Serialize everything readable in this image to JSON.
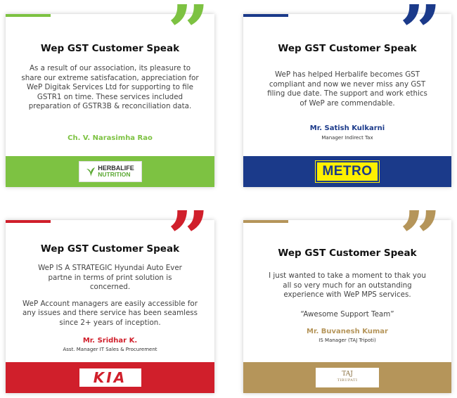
{
  "colors": {
    "green": "#7dc242",
    "blue": "#1b3a8a",
    "red": "#d01f2b",
    "gold": "#b5955a",
    "metro_yellow": "#fff000"
  },
  "quote_glyph": "”",
  "cards": [
    {
      "title": "Wep GST Customer Speak",
      "body": [
        "As a result of our association, its pleasure to share our extreme satisfacation, appreciation for WeP Digitak Services Ltd for supporting to file GSTR1 on time. These services included preparation of GSTR3B & reconciliation data."
      ],
      "name": "Ch. V. Narasimha Rao",
      "role": "",
      "logo": {
        "icon": "herbalife-leaf-icon",
        "line1": "HERBALIFE",
        "line2": "NUTRITION"
      }
    },
    {
      "title": "Wep GST Customer Speak",
      "body": [
        "WeP has  helped Herbalife becomes GST compliant and now we never miss any GST filing due date. The support and work ethics of WeP are commendable."
      ],
      "name": "Mr. Satish Kulkarni",
      "role": "Manager Indirect Tax",
      "logo": {
        "text": "METRO"
      }
    },
    {
      "title": "Wep GST Customer Speak",
      "body": [
        "WeP IS A STRATEGIC Hyundai Auto Ever partne in terms of print solution is concerned.",
        "WeP Account managers are easily accessible for any issues and there service has been seamless since 2+ years of inception."
      ],
      "name": "Mr. Sridhar K.",
      "role": "Asst. Manager IT Sales & Procurement",
      "logo": {
        "text": "KIA"
      }
    },
    {
      "title": "Wep GST Customer Speak",
      "body": [
        "I just wanted to take a moment to thak you all so very much for an outstanding experience with WeP MPS services.",
        "“Awesome Support Team”"
      ],
      "name": "Mr. Buvanesh Kumar",
      "role": "IS Manager (TAJ Tripoti)",
      "logo": {
        "line1": "TAJ",
        "line2": "TIRUPATI"
      }
    }
  ]
}
